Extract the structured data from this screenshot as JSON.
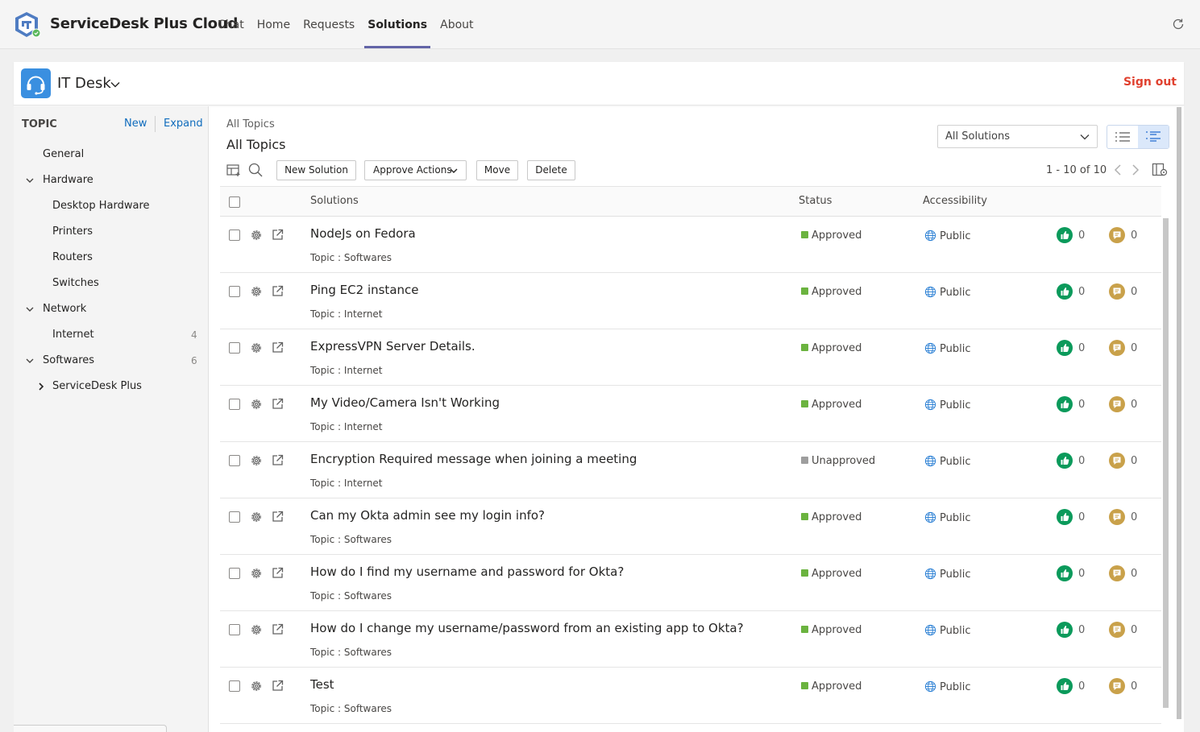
{
  "app": {
    "title": "ServiceDesk Plus Cloud"
  },
  "nav": {
    "tabs": [
      "Chat",
      "Home",
      "Requests",
      "Solutions",
      "About"
    ],
    "active": "Solutions"
  },
  "header": {
    "desk_name": "IT Desk",
    "signout_label": "Sign out"
  },
  "sidebar": {
    "title": "TOPIC",
    "new_label": "New",
    "expand_label": "Expand",
    "items": [
      {
        "label": "General",
        "level": 0,
        "caret": "none",
        "count": ""
      },
      {
        "label": "Hardware",
        "level": 0,
        "caret": "expanded",
        "count": ""
      },
      {
        "label": "Desktop Hardware",
        "level": 1,
        "caret": "none",
        "count": ""
      },
      {
        "label": "Printers",
        "level": 1,
        "caret": "none",
        "count": ""
      },
      {
        "label": "Routers",
        "level": 1,
        "caret": "none",
        "count": ""
      },
      {
        "label": "Switches",
        "level": 1,
        "caret": "none",
        "count": ""
      },
      {
        "label": "Network",
        "level": 0,
        "caret": "expanded",
        "count": ""
      },
      {
        "label": "Internet",
        "level": 1,
        "caret": "none",
        "count": "4"
      },
      {
        "label": "Softwares",
        "level": 0,
        "caret": "expanded",
        "count": "6"
      },
      {
        "label": "ServiceDesk Plus",
        "level": 1,
        "caret": "collapsed",
        "count": ""
      }
    ]
  },
  "content": {
    "breadcrumb": "All Topics",
    "title": "All Topics",
    "filter_selected": "All Solutions",
    "toolbar": {
      "new_solution": "New Solution",
      "approve_actions": "Approve Actions",
      "move": "Move",
      "delete": "Delete"
    },
    "pager": "1 - 10 of 10",
    "columns": {
      "solutions": "Solutions",
      "status": "Status",
      "accessibility": "Accessibility"
    },
    "topic_prefix": "Topic : ",
    "rows": [
      {
        "subject": "NodeJs on Fedora",
        "topic": "Softwares",
        "status": "Approved",
        "access": "Public",
        "likes": "0",
        "comments": "0"
      },
      {
        "subject": "Ping EC2 instance",
        "topic": "Internet",
        "status": "Approved",
        "access": "Public",
        "likes": "0",
        "comments": "0"
      },
      {
        "subject": "ExpressVPN Server Details.",
        "topic": "Internet",
        "status": "Approved",
        "access": "Public",
        "likes": "0",
        "comments": "0"
      },
      {
        "subject": "My Video/Camera Isn't Working",
        "topic": "Internet",
        "status": "Approved",
        "access": "Public",
        "likes": "0",
        "comments": "0"
      },
      {
        "subject": "Encryption Required message when joining a meeting",
        "topic": "Internet",
        "status": "Unapproved",
        "access": "Public",
        "likes": "0",
        "comments": "0"
      },
      {
        "subject": "Can my Okta admin see my login info?",
        "topic": "Softwares",
        "status": "Approved",
        "access": "Public",
        "likes": "0",
        "comments": "0"
      },
      {
        "subject": "How do I find my username and password for Okta?",
        "topic": "Softwares",
        "status": "Approved",
        "access": "Public",
        "likes": "0",
        "comments": "0"
      },
      {
        "subject": "How do I change my username/password from an existing app to Okta?",
        "topic": "Softwares",
        "status": "Approved",
        "access": "Public",
        "likes": "0",
        "comments": "0"
      },
      {
        "subject": "Test",
        "topic": "Softwares",
        "status": "Approved",
        "access": "Public",
        "likes": "0",
        "comments": "0"
      }
    ]
  },
  "colors": {
    "accent": "#6264a7",
    "approved": "#6bb33f",
    "unapproved": "#9e9e9e",
    "signout": "#e0412f",
    "like": "#0b9a5b",
    "comment": "#c9a14a",
    "link": "#0f6cbd"
  }
}
